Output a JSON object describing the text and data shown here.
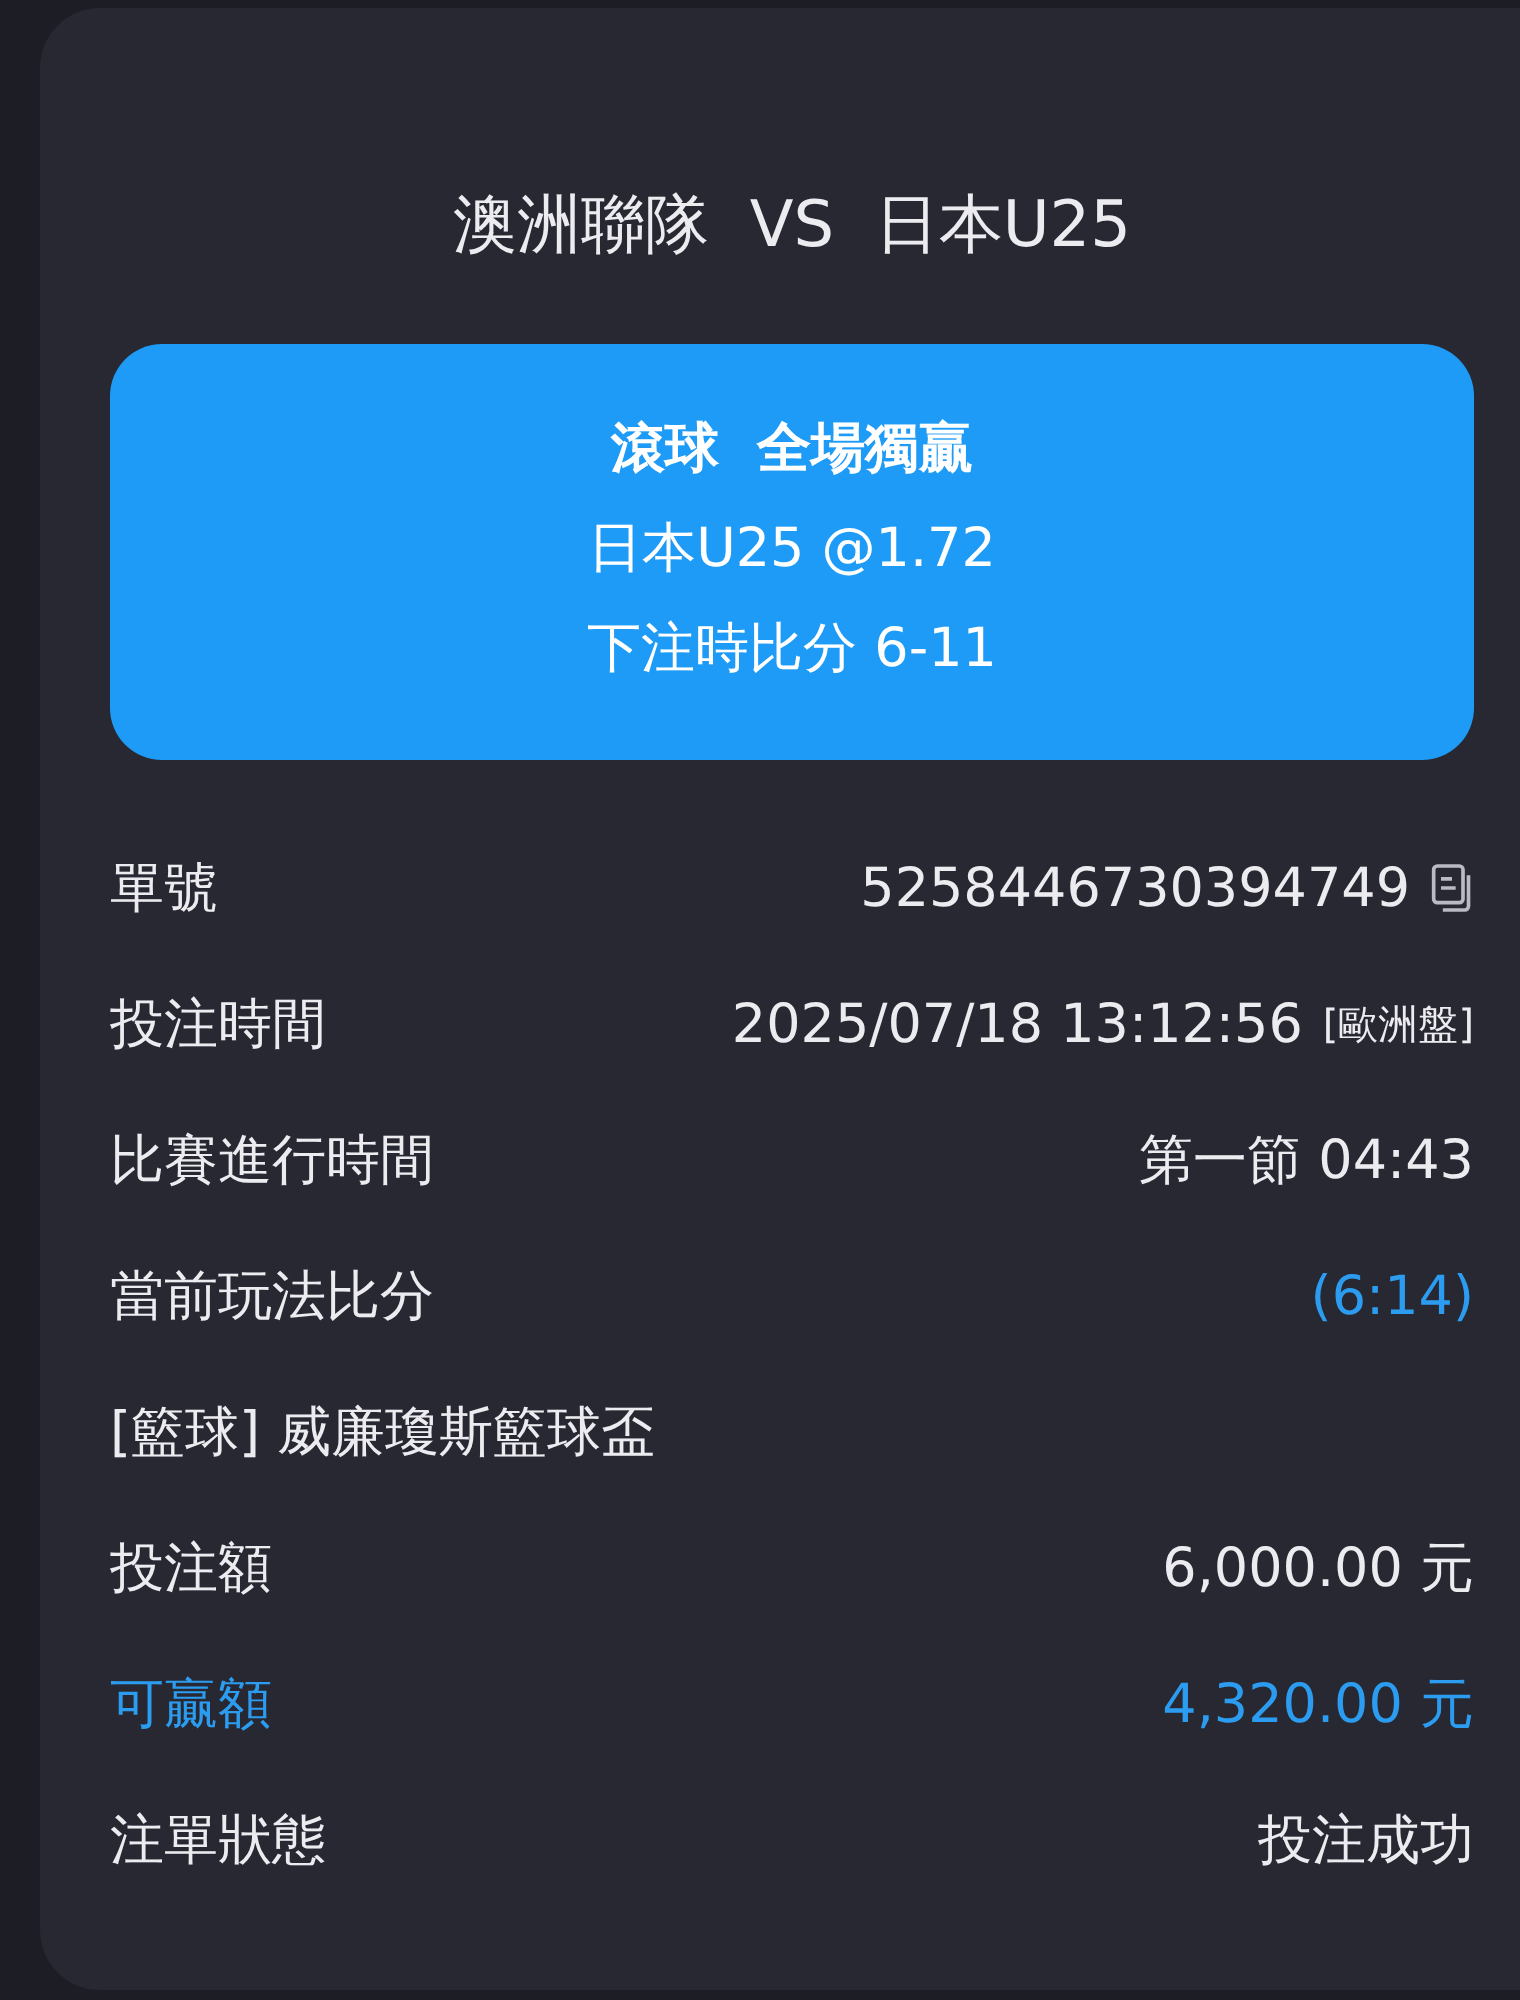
{
  "title": "澳洲聯隊  VS  日本U25",
  "bet_card": {
    "heading": "滾球  全場獨贏",
    "selection": "日本U25 @1.72",
    "score_at_bet": "下注時比分 6-11"
  },
  "details": [
    {
      "kind": "copyable",
      "label": "單號",
      "value": "5258446730394749"
    },
    {
      "kind": "plain",
      "label": "投注時間",
      "value": "2025/07/18 13:12:56",
      "note": "[歐洲盤]"
    },
    {
      "kind": "plain",
      "label": "比賽進行時間",
      "value": "第一節 04:43"
    },
    {
      "kind": "live",
      "label": "當前玩法比分",
      "value": "(6:14)"
    },
    {
      "kind": "heading",
      "label": "[籃球] 威廉瓊斯籃球盃"
    },
    {
      "kind": "plain",
      "label": "投注額",
      "value": "6,000.00 元"
    },
    {
      "kind": "payout",
      "label": "可贏額",
      "value": "4,320.00 元"
    },
    {
      "kind": "plain",
      "label": "注單狀態",
      "value": "投注成功"
    }
  ]
}
